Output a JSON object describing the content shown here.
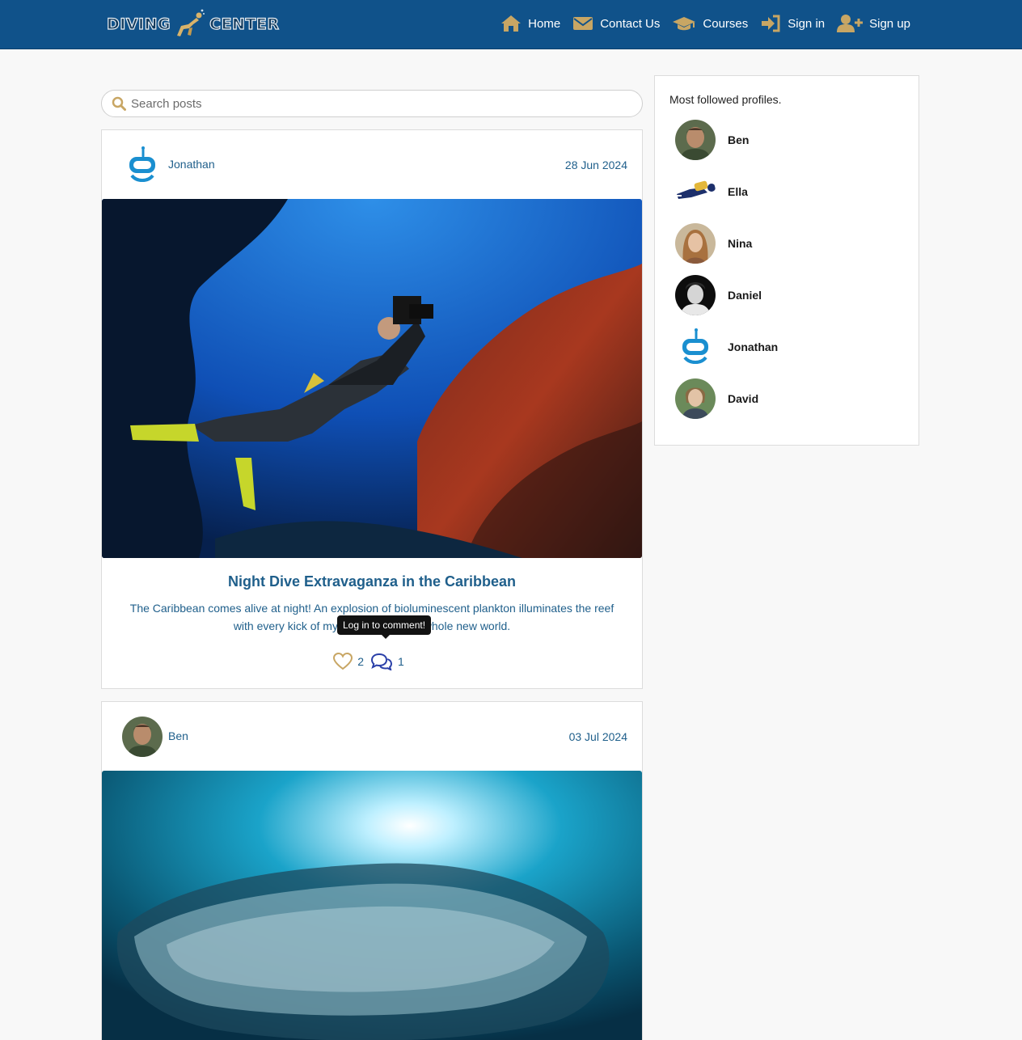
{
  "brand": {
    "word1": "DIVING",
    "word2": "CENTER"
  },
  "nav": [
    {
      "label": "Home",
      "icon": "home-icon"
    },
    {
      "label": "Contact Us",
      "icon": "envelope-icon"
    },
    {
      "label": "Courses",
      "icon": "graduation-cap-icon"
    },
    {
      "label": "Sign in",
      "icon": "sign-in-icon"
    },
    {
      "label": "Sign up",
      "icon": "user-plus-icon"
    }
  ],
  "search": {
    "placeholder": "Search posts",
    "icon": "search-icon"
  },
  "posts": [
    {
      "author": "Jonathan",
      "date": "28 Jun 2024",
      "title": "Night Dive Extravaganza in the Caribbean",
      "body": "The Caribbean comes alive at night! An explosion of bioluminescent plankton illuminates the reef with every kick of my fins, revealing a whole new world.",
      "likes": "2",
      "comments": "1",
      "tooltip": "Log in to comment!"
    },
    {
      "author": "Ben",
      "date": "03 Jul 2024"
    }
  ],
  "sidebar": {
    "title": "Most followed profiles.",
    "profiles": [
      {
        "name": "Ben"
      },
      {
        "name": "Ella"
      },
      {
        "name": "Nina"
      },
      {
        "name": "Daniel"
      },
      {
        "name": "Jonathan"
      },
      {
        "name": "David"
      }
    ]
  },
  "colors": {
    "navbar": "#10528a",
    "accent_gold": "#c8a664",
    "link_blue": "#1f5f8b",
    "comment_blue": "#2a3fa8"
  }
}
